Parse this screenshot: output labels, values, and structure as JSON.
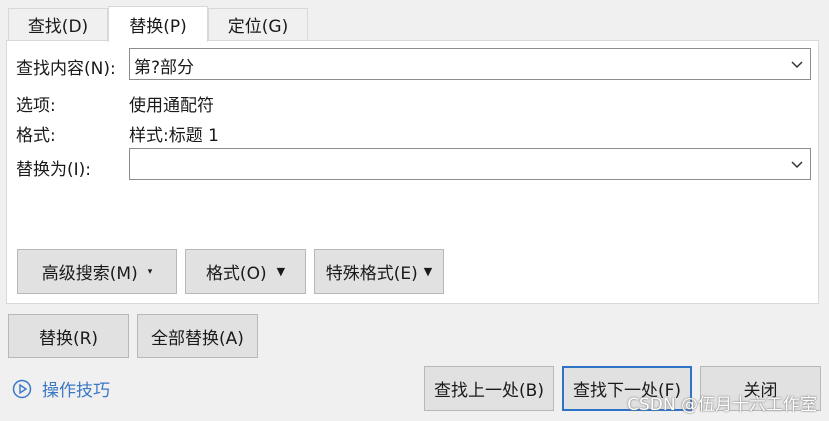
{
  "tabs": [
    "查找(D)",
    "替换(P)",
    "定位(G)"
  ],
  "find": {
    "label": "查找内容(N):",
    "value": "第?部分"
  },
  "options": {
    "label": "选项:",
    "value": "使用通配符"
  },
  "format": {
    "label": "格式:",
    "value": "样式:标题 1"
  },
  "replace": {
    "label": "替换为(I):",
    "value": ""
  },
  "panel_buttons": {
    "advanced": "高级搜索(M)",
    "format": "格式(O)",
    "special": "特殊格式(E)"
  },
  "action_buttons": {
    "replace": "替换(R)",
    "replace_all": "全部替换(A)"
  },
  "tips": {
    "label": "操作技巧",
    "icon": "play-circle-icon"
  },
  "footer_buttons": {
    "find_prev": "查找上一处(B)",
    "find_next": "查找下一处(F)",
    "close": "关闭"
  },
  "watermark": "CSDN @伍月十六工作室",
  "colors": {
    "accent": "#2f73c7",
    "tips_text": "#3a78c6",
    "button_bg": "#e1e1e1"
  }
}
